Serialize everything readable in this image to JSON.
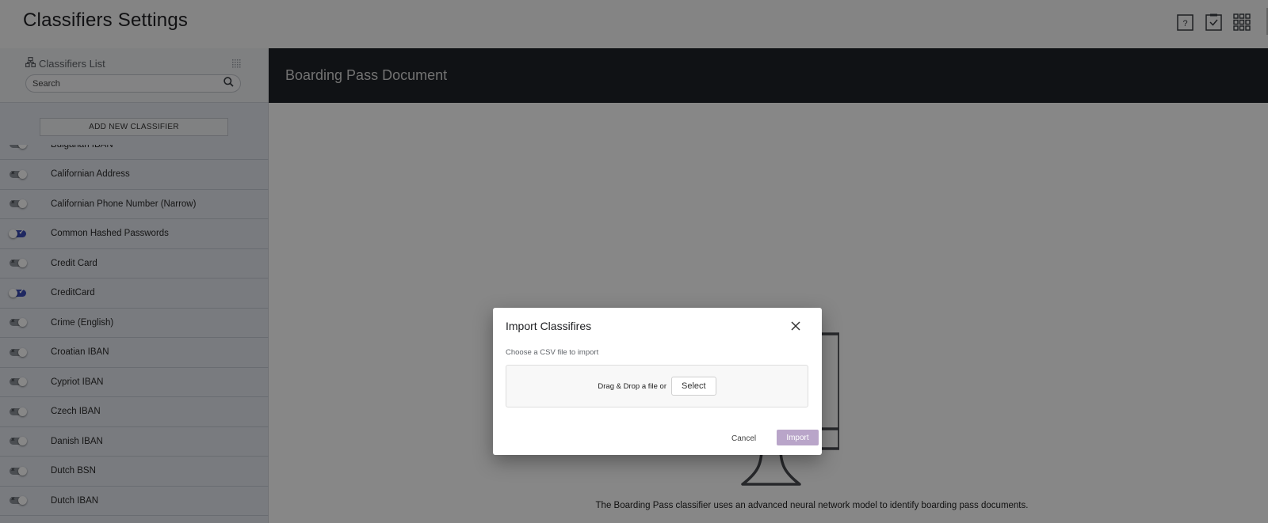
{
  "header": {
    "title": "Classifiers Settings",
    "icons": [
      "help-icon",
      "tasks-icon",
      "apps-grid-icon"
    ]
  },
  "sidebar": {
    "list_title": "Classifiers List",
    "search_placeholder": "Search",
    "add_button_label": "ADD NEW CLASSIFIER",
    "items": [
      {
        "label": "Bulgarian IBAN",
        "enabled": false
      },
      {
        "label": "Californian Address",
        "enabled": false
      },
      {
        "label": "Californian Phone Number (Narrow)",
        "enabled": false
      },
      {
        "label": "Common Hashed Passwords",
        "enabled": true
      },
      {
        "label": "Credit Card",
        "enabled": false
      },
      {
        "label": "CreditCard",
        "enabled": true
      },
      {
        "label": "Crime (English)",
        "enabled": false
      },
      {
        "label": "Croatian IBAN",
        "enabled": false
      },
      {
        "label": "Cypriot IBAN",
        "enabled": false
      },
      {
        "label": "Czech IBAN",
        "enabled": false
      },
      {
        "label": "Danish IBAN",
        "enabled": false
      },
      {
        "label": "Dutch BSN",
        "enabled": false
      },
      {
        "label": "Dutch IBAN",
        "enabled": false
      }
    ]
  },
  "main": {
    "title": "Boarding Pass Document",
    "description": "The Boarding Pass classifier uses an advanced neural network model to identify boarding pass documents."
  },
  "dialog": {
    "title": "Import Classifires",
    "subtitle": "Choose a CSV file to import",
    "drop_text": "Drag & Drop a file or",
    "select_label": "Select",
    "cancel_label": "Cancel",
    "import_label": "Import"
  },
  "colors": {
    "content_header_bg": "#1f2228",
    "toggle_on": "#3b4db8",
    "import_button": "#b9a5c9"
  }
}
